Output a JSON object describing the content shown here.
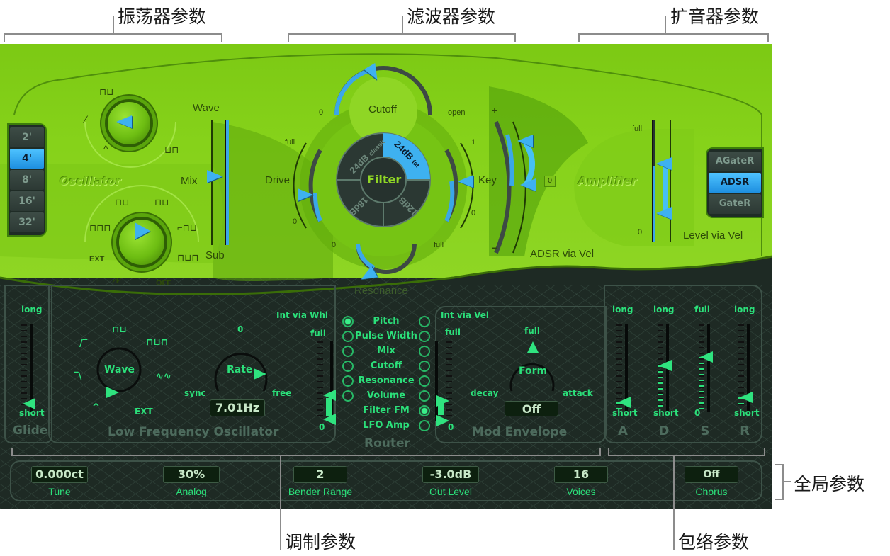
{
  "annotations": {
    "oscillator_params": "振荡器参数",
    "filter_params": "滤波器参数",
    "amplifier_params": "扩音器参数",
    "modulation_params": "调制参数",
    "envelope_params": "包络参数",
    "global_params": "全局参数"
  },
  "oscillator": {
    "title": "Oscillator",
    "octave_buttons": [
      "2'",
      "4'",
      "8'",
      "16'",
      "32'"
    ],
    "octave_selected": "4'",
    "wave_label": "Wave",
    "mix_label": "Mix",
    "sub_label": "Sub",
    "sub_knob_labels": {
      "ext": "EXT",
      "off": "OFF"
    },
    "mix_value_fraction": 0.5
  },
  "filter": {
    "title": "Filter",
    "cutoff_label": "Cutoff",
    "cutoff_min": "0",
    "cutoff_max": "open",
    "drive_label": "Drive",
    "drive_max": "full",
    "drive_min": "0",
    "key_label": "Key",
    "key_max": "1",
    "key_min": "0",
    "resonance_label": "Resonance",
    "resonance_min": "0",
    "resonance_max": "full",
    "modes": [
      {
        "label": "24dB",
        "sub": "classic"
      },
      {
        "label": "24dB",
        "sub": "fat"
      },
      {
        "label": "12dB",
        "sub": ""
      },
      {
        "label": "18dB",
        "sub": ""
      }
    ],
    "mode_selected": "24dB fat"
  },
  "amplifier": {
    "title": "Amplifier",
    "adsr_via_vel_label": "ADSR via Vel",
    "adsr_plus": "+",
    "adsr_minus": "−",
    "adsr_zero_btn": "0",
    "level_max": "full",
    "level_min": "0",
    "level_via_vel_label": "Level via Vel",
    "env_modes": [
      "AGateR",
      "ADSR",
      "GateR"
    ],
    "env_mode_selected": "ADSR"
  },
  "glide": {
    "title": "Glide",
    "max": "long",
    "min": "short"
  },
  "lfo": {
    "title": "Low Frequency Oscillator",
    "wave_label": "Wave",
    "wave_ext": "EXT",
    "rate_label": "Rate",
    "rate_zero": "0",
    "rate_sync": "sync",
    "rate_free": "free",
    "rate_value": "7.01Hz",
    "int_via_whl_label": "Int via Whl",
    "int_max": "full",
    "int_min": "0"
  },
  "router": {
    "title": "Router",
    "targets": [
      "Pitch",
      "Pulse Width",
      "Mix",
      "Cutoff",
      "Resonance",
      "Volume",
      "Filter FM",
      "LFO Amp"
    ],
    "lfo_selected": "Pitch",
    "env_selected": "Filter FM"
  },
  "mod_envelope": {
    "title": "Mod Envelope",
    "int_via_vel_label": "Int via Vel",
    "int_max": "full",
    "int_min": "0",
    "form_label": "Form",
    "form_max": "full",
    "form_decay": "decay",
    "form_attack": "attack",
    "value": "Off"
  },
  "envelope": {
    "sliders": [
      {
        "letter": "A",
        "top": "long",
        "bottom": "short",
        "value_fraction": 0.08
      },
      {
        "letter": "D",
        "top": "long",
        "bottom": "short",
        "value_fraction": 0.52
      },
      {
        "letter": "S",
        "top": "full",
        "bottom": "0",
        "value_fraction": 0.62
      },
      {
        "letter": "R",
        "top": "long",
        "bottom": "short",
        "value_fraction": 0.14
      }
    ]
  },
  "global": {
    "tune": {
      "label": "Tune",
      "value": "0.000ct"
    },
    "analog": {
      "label": "Analog",
      "value": "30%"
    },
    "bender": {
      "label": "Bender Range",
      "value": "2"
    },
    "out_level": {
      "label": "Out Level",
      "value": "-3.0dB"
    },
    "voices": {
      "label": "Voices",
      "value": "16"
    },
    "chorus": {
      "label": "Chorus",
      "value": "Off"
    }
  }
}
